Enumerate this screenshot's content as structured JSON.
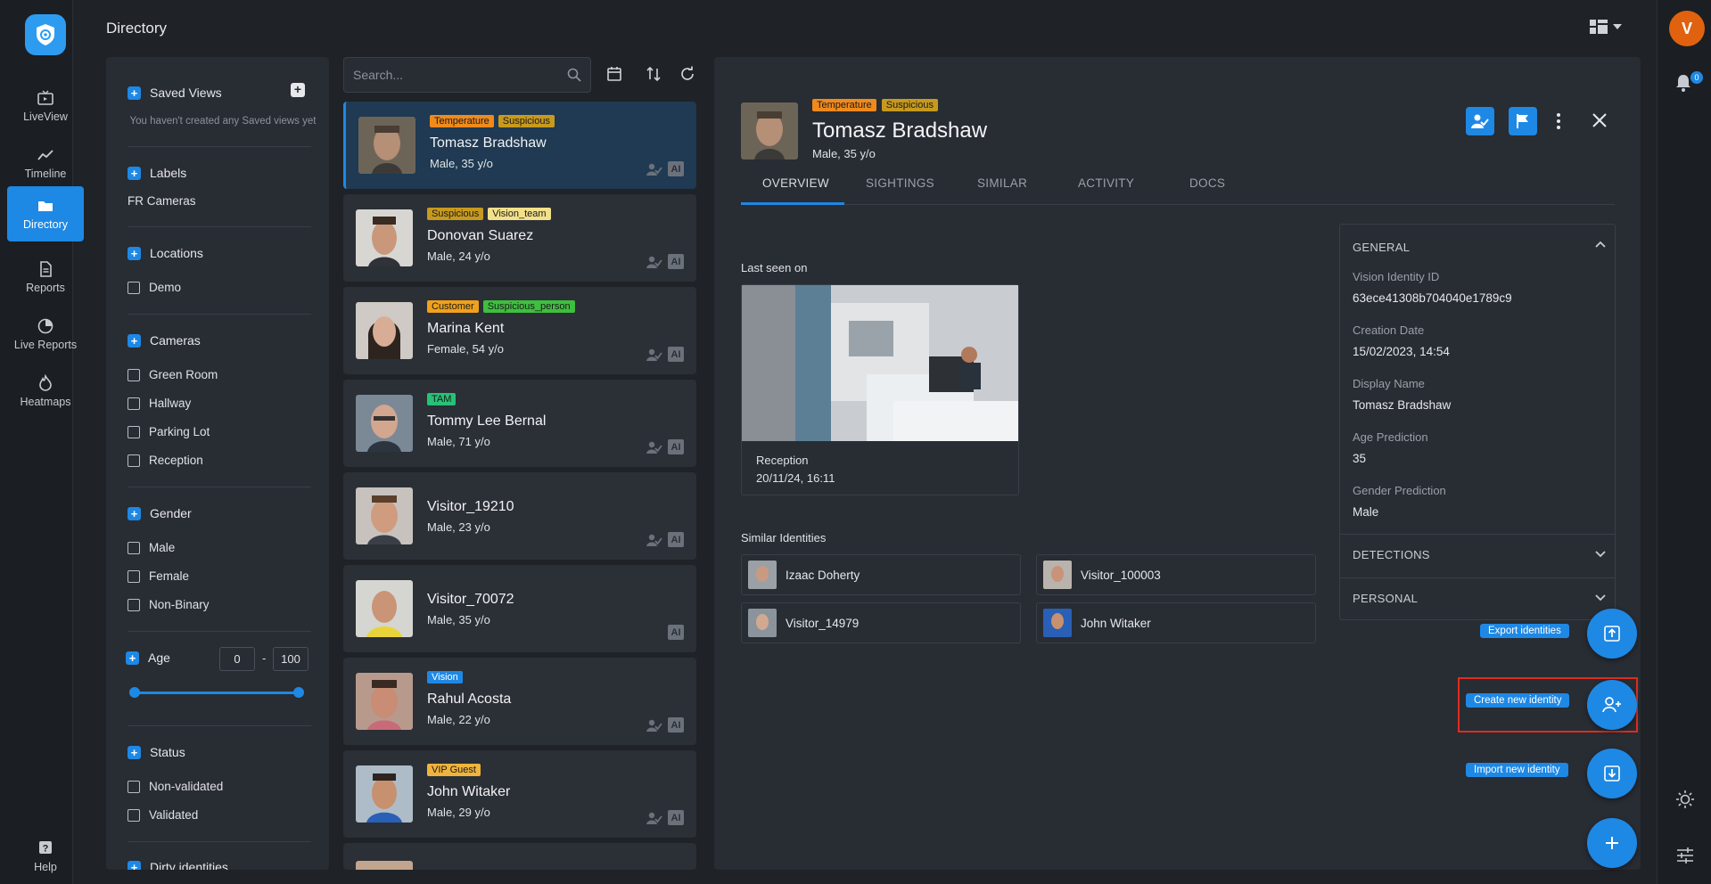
{
  "nav": {
    "items": [
      {
        "label": "LiveView"
      },
      {
        "label": "Timeline"
      },
      {
        "label": "Directory"
      },
      {
        "label": "Reports"
      },
      {
        "label": "Live Reports"
      },
      {
        "label": "Heatmaps"
      }
    ],
    "help": "Help"
  },
  "header": {
    "title": "Directory"
  },
  "user": {
    "initial": "V",
    "notifications": "0"
  },
  "filters": {
    "saved_views": "Saved Views",
    "saved_views_empty": "You haven't created any Saved views yet",
    "labels": "Labels",
    "labels_value": "FR Cameras",
    "locations": "Locations",
    "location_items": [
      "Demo"
    ],
    "cameras": "Cameras",
    "camera_items": [
      "Green Room",
      "Hallway",
      "Parking Lot",
      "Reception"
    ],
    "gender": "Gender",
    "gender_items": [
      "Male",
      "Female",
      "Non-Binary"
    ],
    "age": "Age",
    "age_min": "0",
    "age_sep": "-",
    "age_max": "100",
    "status": "Status",
    "status_items": [
      "Non-validated",
      "Validated"
    ],
    "dirty": "Dirty identities"
  },
  "search": {
    "placeholder": "Search..."
  },
  "list": [
    {
      "name": "Tomasz Bradshaw",
      "meta": "Male, 35 y/o",
      "tags": [
        "Temperature",
        "Suspicious"
      ]
    },
    {
      "name": "Donovan Suarez",
      "meta": "Male, 24 y/o",
      "tags": [
        "Suspicious",
        "Vision_team"
      ]
    },
    {
      "name": "Marina Kent",
      "meta": "Female, 54 y/o",
      "tags": [
        "Customer",
        "Suspicious_person"
      ]
    },
    {
      "name": "Tommy Lee Bernal",
      "meta": "Male, 71 y/o",
      "tags": [
        "TAM"
      ]
    },
    {
      "name": "Visitor_19210",
      "meta": "Male, 23 y/o",
      "tags": []
    },
    {
      "name": "Visitor_70072",
      "meta": "Male, 35 y/o",
      "tags": []
    },
    {
      "name": "Rahul Acosta",
      "meta": "Male, 22 y/o",
      "tags": [
        "Vision"
      ]
    },
    {
      "name": "John Witaker",
      "meta": "Male, 29 y/o",
      "tags": [
        "VIP Guest"
      ]
    }
  ],
  "ai_label": "AI",
  "tag_colors": {
    "Temperature": "#f08a1c",
    "Suspicious": "#c79a1e",
    "Vision_team": "#f3e08a",
    "Customer": "#f0a11c",
    "Suspicious_person": "#3fbf3f",
    "TAM": "#26c276",
    "Vision": "#1e88e5",
    "VIP Guest": "#f0b43c"
  },
  "detail": {
    "name": "Tomasz Bradshaw",
    "meta": "Male, 35 y/o",
    "tags": [
      "Temperature",
      "Suspicious"
    ],
    "tabs": [
      "OVERVIEW",
      "SIGHTINGS",
      "SIMILAR",
      "ACTIVITY",
      "DOCS"
    ],
    "last_seen_title": "Last seen on",
    "last_seen_location": "Reception",
    "last_seen_time": "20/11/24, 16:11",
    "similar_title": "Similar Identities",
    "similar": [
      "Izaac Doherty",
      "Visitor_100003",
      "Visitor_14979",
      "John Witaker"
    ],
    "general_title": "GENERAL",
    "fields": [
      {
        "label": "Vision Identity ID",
        "value": "63ece41308b704040e1789c9"
      },
      {
        "label": "Creation Date",
        "value": "15/02/2023, 14:54"
      },
      {
        "label": "Display Name",
        "value": "Tomasz Bradshaw"
      },
      {
        "label": "Age Prediction",
        "value": "35"
      },
      {
        "label": "Gender Prediction",
        "value": "Male"
      }
    ],
    "detections_title": "DETECTIONS",
    "personal_title": "PERSONAL"
  },
  "actions": {
    "export": "Export identities",
    "create": "Create new identity",
    "import": "Import new identity"
  },
  "colors": {
    "accent": "#1e88e5",
    "highlight": "#e02c1e"
  }
}
